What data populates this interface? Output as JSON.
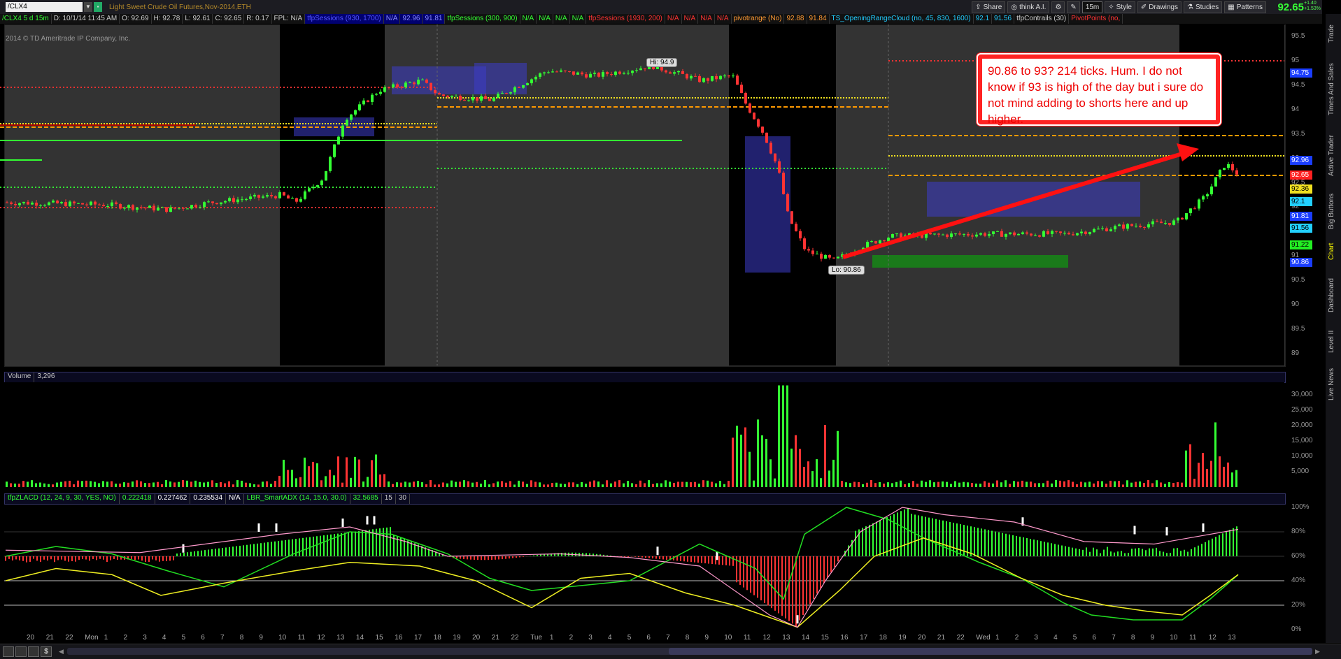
{
  "toolbar": {
    "symbol": "/CLX4",
    "title": "Light Sweet Crude Oil Futures,Nov-2014,ETH",
    "buttons": [
      "Share",
      "think A.I.",
      "15m",
      "Style",
      "Drawings",
      "Studies",
      "Patterns"
    ],
    "last_price": "92.65",
    "change_top": "+1.40",
    "change_bottom": "+1.53%"
  },
  "infobar": {
    "items": [
      "/CLX4 5 d 15m",
      "D: 10/1/14 11:45 AM",
      "O: 92.69",
      "H: 92.78",
      "L: 92.61",
      "C: 92.65",
      "R: 0.17",
      "FPL: N/A",
      "tfpSessions (930, 1700)",
      "N/A",
      "92.96",
      "91.81",
      "tfpSessions (300, 900)",
      "N/A",
      "N/A",
      "N/A",
      "N/A",
      "tfpSessions (1930, 200)",
      "N/A",
      "N/A",
      "N/A",
      "N/A",
      "pivotrange (No)",
      "92.88",
      "91.84",
      "TS_OpeningRangeCloud (no, 45, 830, 1600)",
      "92.1",
      "91.56",
      "tfpContrails (30)",
      "PivotPoints (no,"
    ]
  },
  "copyright": "2014 © TD Ameritrade IP Company, Inc.",
  "price_axis": [
    "95.5",
    "95",
    "94.5",
    "94",
    "93.5",
    "93",
    "92.5",
    "92",
    "91.5",
    "91",
    "90.5",
    "90",
    "89.5",
    "89"
  ],
  "price_tags": [
    {
      "v": "94.75",
      "bg": "#1a3dff",
      "fg": "#ffffff"
    },
    {
      "v": "92.96",
      "bg": "#1a3dff",
      "fg": "#ffffff"
    },
    {
      "v": "92.65",
      "bg": "#ff2020",
      "fg": "#ffffff"
    },
    {
      "v": "92.36",
      "bg": "#f0e020",
      "fg": "#000000"
    },
    {
      "v": "92.1",
      "bg": "#22d0ff",
      "fg": "#000000"
    },
    {
      "v": "91.81",
      "bg": "#1a3dff",
      "fg": "#ffffff"
    },
    {
      "v": "91.56",
      "bg": "#22d0ff",
      "fg": "#000000"
    },
    {
      "v": "91.22",
      "bg": "#22ee22",
      "fg": "#000000"
    },
    {
      "v": "90.86",
      "bg": "#1a3dff",
      "fg": "#ffffff"
    }
  ],
  "hi_label": "Hi: 94.9",
  "lo_label": "Lo: 90.86",
  "annotation": "90.86 to 93?  214 ticks. Hum. I do not know if 93 is high of the day but i sure do not mind adding to shorts here and up higher.",
  "volume": {
    "label": "Volume",
    "value": "3,296",
    "axis": [
      "30,000",
      "25,000",
      "20,000",
      "15,000",
      "10,000",
      "5,000"
    ]
  },
  "osc": {
    "items": [
      "tfpZLACD (12, 24, 9, 30, YES, NO)",
      "0.222418",
      "0.227462",
      "0.235534",
      "N/A",
      "LBR_SmartADX (14, 15.0, 30.0)",
      "32.5685",
      "15",
      "30"
    ],
    "axis": [
      "100%",
      "80%",
      "60%",
      "40%",
      "20%",
      "0%"
    ]
  },
  "time_axis": [
    "20",
    "21",
    "22",
    "Mon",
    "1",
    "2",
    "3",
    "4",
    "5",
    "6",
    "7",
    "8",
    "9",
    "10",
    "11",
    "12",
    "13",
    "14",
    "15",
    "16",
    "17",
    "18",
    "19",
    "20",
    "21",
    "22",
    "Tue",
    "1",
    "2",
    "3",
    "4",
    "5",
    "6",
    "7",
    "8",
    "9",
    "10",
    "11",
    "12",
    "13",
    "14",
    "15",
    "16",
    "17",
    "18",
    "19",
    "20",
    "21",
    "22",
    "Wed",
    "1",
    "2",
    "3",
    "4",
    "5",
    "6",
    "7",
    "8",
    "9",
    "10",
    "11",
    "12",
    "13"
  ],
  "side_tabs": [
    "Trade",
    "Times And Sales",
    "Active Trader",
    "Big Buttons",
    "Chart",
    "Dashboard",
    "Level II",
    "Live News"
  ]
}
